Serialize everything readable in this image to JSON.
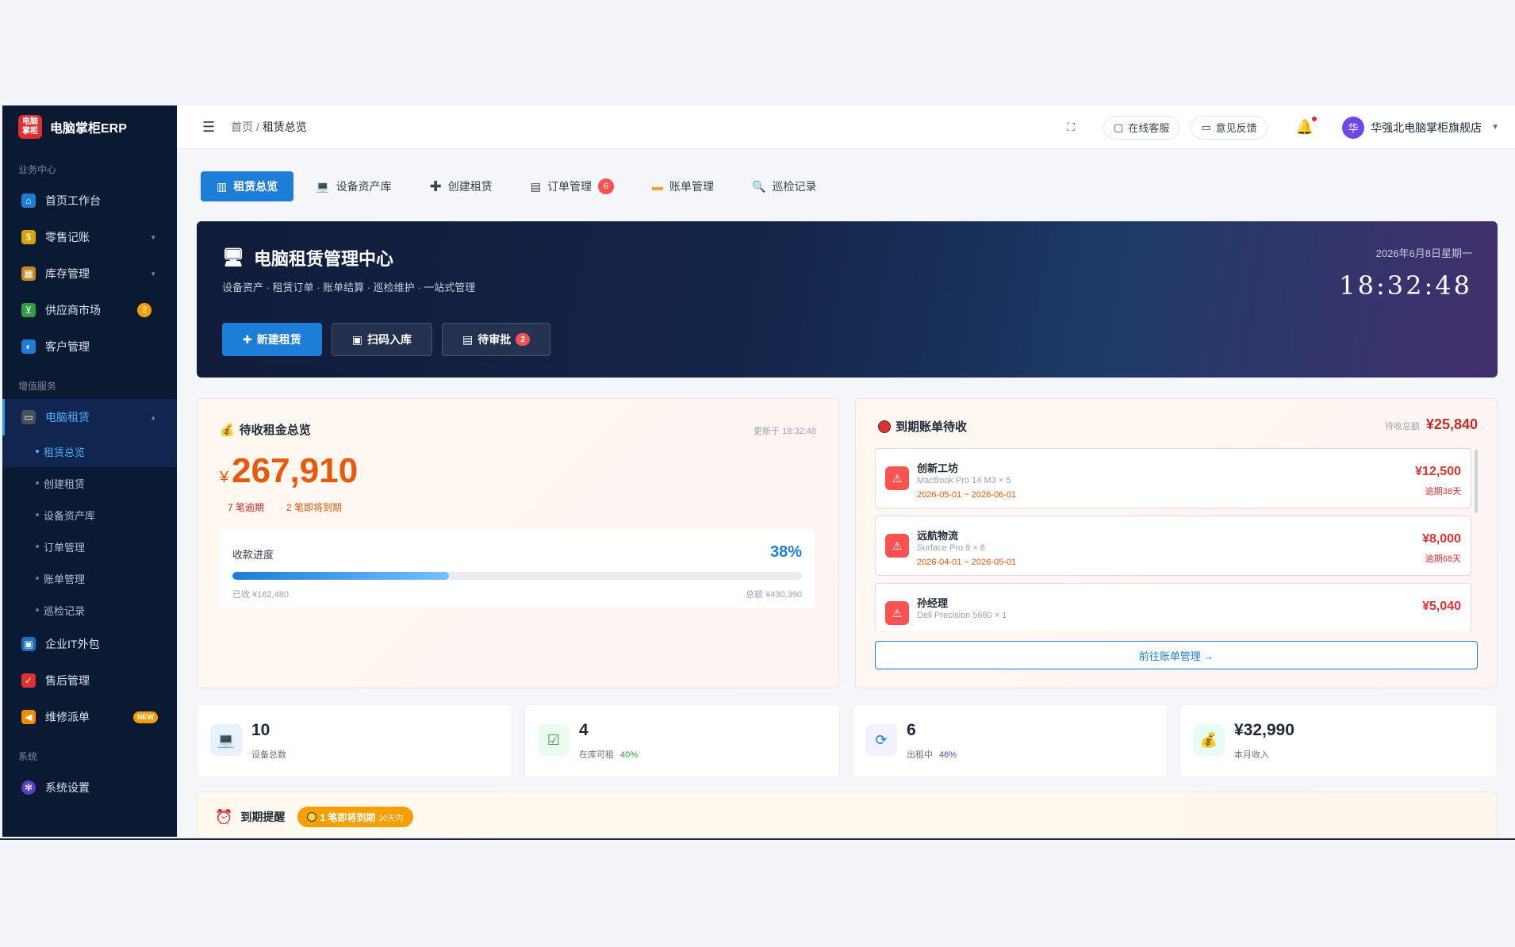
{
  "brand": {
    "logo_text": "电脑掌柜",
    "name": "电脑掌柜ERP"
  },
  "sidebar": {
    "groups": [
      {
        "title": "业务中心"
      },
      {
        "title": "增值服务"
      },
      {
        "title": "系统"
      }
    ],
    "items": [
      {
        "label": "首页工作台",
        "icon": "home-icon"
      },
      {
        "label": "零售记账",
        "icon": "money-bag-icon"
      },
      {
        "label": "库存管理",
        "icon": "box-icon"
      },
      {
        "label": "供应商市场",
        "icon": "cart-icon",
        "badge": "2"
      },
      {
        "label": "客户管理",
        "icon": "user-icon"
      },
      {
        "label": "电脑租赁",
        "icon": "computer-icon"
      },
      {
        "label": "企业IT外包",
        "icon": "monitor-icon"
      },
      {
        "label": "售后管理",
        "icon": "shield-icon"
      },
      {
        "label": "维修派单",
        "icon": "megaphone-icon",
        "badge": "NEW"
      },
      {
        "label": "系统设置",
        "icon": "gear-icon"
      }
    ],
    "sub_items": [
      "租赁总览",
      "创建租赁",
      "设备资产库",
      "订单管理",
      "账单管理",
      "巡检记录"
    ]
  },
  "topbar": {
    "breadcrumb_home": "首页",
    "breadcrumb_sep": " / ",
    "breadcrumb_current": "租赁总览",
    "online_service": "在线客服",
    "feedback": "意见反馈",
    "avatar_text": "华",
    "store_name": "华强北电脑掌柜旗舰店"
  },
  "tabs": [
    {
      "label": "租赁总览",
      "icon": "chart-icon"
    },
    {
      "label": "设备资产库",
      "icon": "laptop-icon"
    },
    {
      "label": "创建租赁",
      "icon": "plus-icon"
    },
    {
      "label": "订单管理",
      "icon": "clipboard-icon",
      "count": "6"
    },
    {
      "label": "账单管理",
      "icon": "card-icon"
    },
    {
      "label": "巡检记录",
      "icon": "magnifier-icon"
    }
  ],
  "hero": {
    "title": "电脑租赁管理中心",
    "subtitle": "设备资产 · 租赁订单 · 账单结算 · 巡检维护 · 一站式管理",
    "date": "2026年6月8日星期一",
    "time": "18:32:48",
    "btn_new": "新建租赁",
    "btn_scan": "扫码入库",
    "btn_pending": "待审批",
    "pending_count": "2"
  },
  "rent_card": {
    "title": "待收租金总览",
    "updated": "更新于 18:32:48",
    "currency": "¥",
    "amount": "267,910",
    "overdue_tag": "7 笔逾期",
    "expiring_tag": "2 笔即将到期",
    "progress_label": "收款进度",
    "progress_pct": "38%",
    "progress_value": 0.38,
    "collected": "已收 ¥162,480",
    "total": "总额 ¥430,390"
  },
  "bills_card": {
    "title": "到期账单待收",
    "total_label": "待收总额",
    "total": "¥25,840",
    "bills": [
      {
        "name": "创新工坊",
        "device": "MacBook Pro 14 M3 × 5",
        "period": "2026-05-01 ~ 2026-06-01",
        "amount": "¥12,500",
        "overdue": "逾期38天"
      },
      {
        "name": "远航物流",
        "device": "Surface Pro 9 × 8",
        "period": "2026-04-01 ~ 2026-05-01",
        "amount": "¥8,000",
        "overdue": "逾期68天"
      },
      {
        "name": "孙经理",
        "device": "Dell Precision 5680 × 1",
        "period": "",
        "amount": "¥5,040",
        "overdue": ""
      }
    ],
    "link": "前往账单管理 →"
  },
  "stats": [
    {
      "value": "10",
      "label": "设备总数",
      "pct": "",
      "icon": "laptop-icon"
    },
    {
      "value": "4",
      "label": "在库可租",
      "pct": "40%",
      "icon": "check-icon"
    },
    {
      "value": "6",
      "label": "出租中",
      "pct": "46%",
      "icon": "refresh-icon"
    },
    {
      "value": "¥32,990",
      "label": "本月收入",
      "pct": "",
      "icon": "money-bag-icon"
    }
  ],
  "reminder": {
    "title": "到期提醒",
    "badge": "1 笔即将到期",
    "badge_sub": "30天内"
  },
  "colors": {
    "sidebar_bg": "#0b1a33",
    "accent": "#1c7ed6",
    "danger": "#e03131",
    "warning": "#f59f00",
    "amount": "#e8590c"
  }
}
